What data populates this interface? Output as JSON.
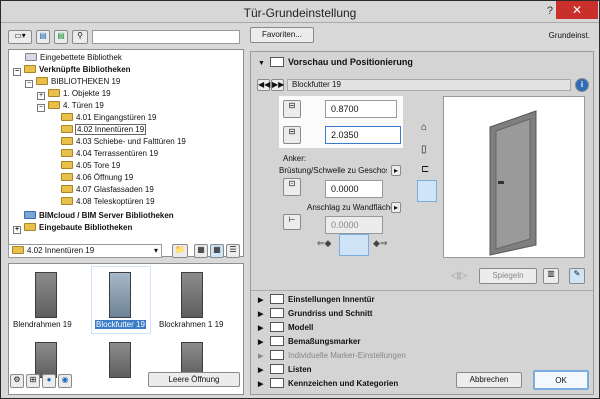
{
  "window": {
    "title": "Tür-Grundeinstellung",
    "help": "?",
    "close": "✕"
  },
  "left": {
    "search_placeholder": "",
    "tree": [
      {
        "label": "Eingebettete Bibliothek",
        "level": 1,
        "bold": false
      },
      {
        "label": "Verknüpfte Bibliotheken",
        "level": 0,
        "bold": true
      },
      {
        "label": "BIBLIOTHEKEN 19",
        "level": 1,
        "bold": false
      },
      {
        "label": "1. Objekte 19",
        "level": 2,
        "bold": false
      },
      {
        "label": "4. Türen 19",
        "level": 2,
        "bold": false
      },
      {
        "label": "4.01 Eingangstüren 19",
        "level": 3,
        "bold": false
      },
      {
        "label": "4.02 Innentüren 19",
        "level": 3,
        "bold": false
      },
      {
        "label": "4.03 Schiebe- und Falttüren 19",
        "level": 3,
        "bold": false
      },
      {
        "label": "4.04 Terrassentüren 19",
        "level": 3,
        "bold": false
      },
      {
        "label": "4.05 Tore 19",
        "level": 3,
        "bold": false
      },
      {
        "label": "4.06 Öffnung 19",
        "level": 3,
        "bold": false
      },
      {
        "label": "4.07 Glasfassaden 19",
        "level": 3,
        "bold": false
      },
      {
        "label": "4.08 Teleskoptüren 19",
        "level": 3,
        "bold": false
      },
      {
        "label": "BIMcloud / BIM Server Bibliotheken",
        "level": 0,
        "bold": true
      },
      {
        "label": "Eingebaute Bibliotheken",
        "level": 0,
        "bold": true
      }
    ],
    "folder_select": "4.02 Innentüren 19",
    "thumbs": [
      "Blendrahmen 19",
      "Blockfutter 19",
      "Blockrahmen 1 19"
    ],
    "empty_opening": "Leere Öffnung"
  },
  "right": {
    "favorites": "Favoriten...",
    "default_label": "Grundeinst.",
    "section_title": "Vorschau und Positionierung",
    "object_name": "Blockfutter 19",
    "width_value": "0.8700",
    "height_value": "2.0350",
    "anchor_label": "Anker:",
    "sill_label": "Brüstung/Schwelle zu Geschoss 0",
    "sill_value": "0.0000",
    "reveal_label": "Anschlag zu Wandfläche",
    "reveal_value": "0.0000",
    "mirror_label": "Spiegeln",
    "sections": [
      {
        "label": "Einstellungen Innentür",
        "grey": false
      },
      {
        "label": "Grundriss und Schnitt",
        "grey": false
      },
      {
        "label": "Modell",
        "grey": false
      },
      {
        "label": "Bemaßungsmarker",
        "grey": false
      },
      {
        "label": "Individuelle Marker-Einstellungen",
        "grey": true
      },
      {
        "label": "Listen",
        "grey": false
      },
      {
        "label": "Kennzeichen und Kategorien",
        "grey": false
      }
    ],
    "cancel": "Abbrechen",
    "ok": "OK"
  }
}
